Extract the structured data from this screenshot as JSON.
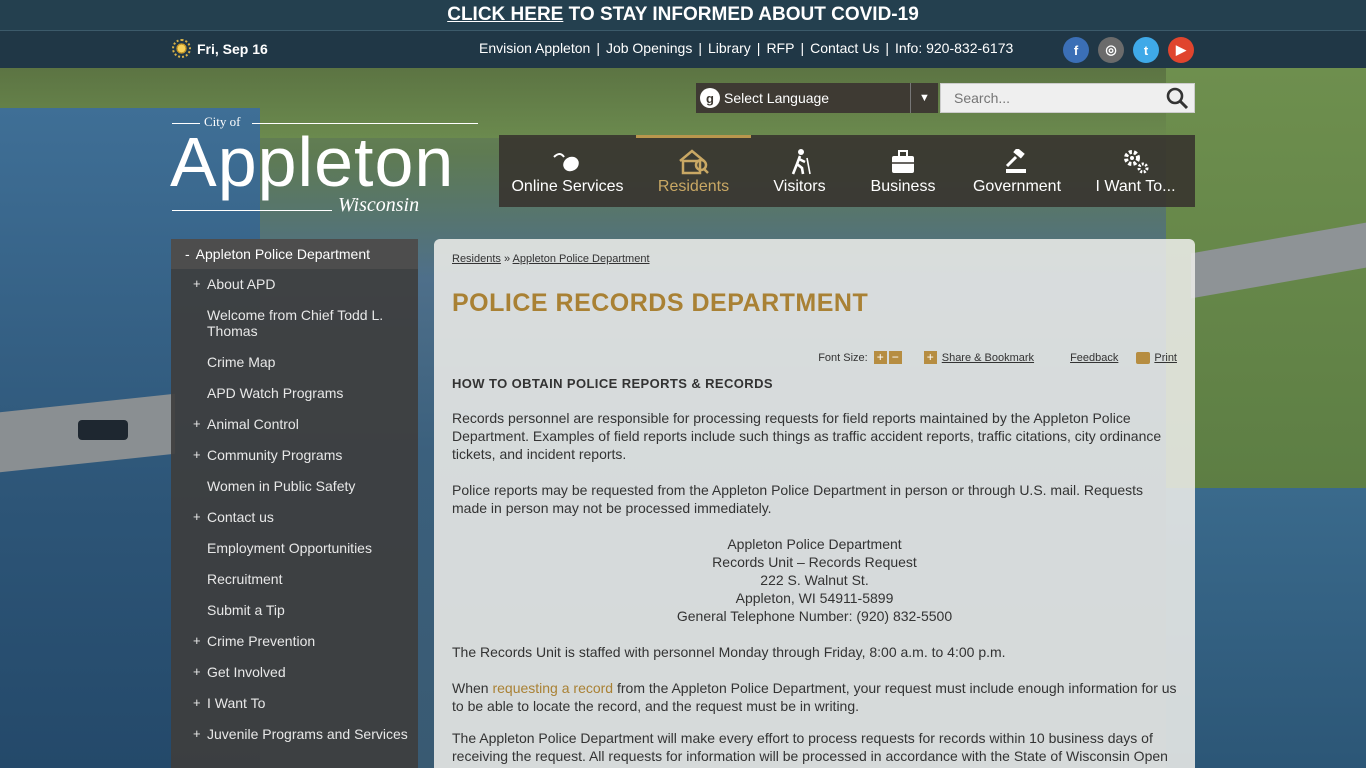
{
  "alert": {
    "link": "CLICK HERE",
    "text": " TO STAY INFORMED ABOUT COVID-19"
  },
  "utility": {
    "date": "Fri, Sep 16",
    "links": [
      "Envision Appleton",
      "Job Openings",
      "Library",
      "RFP",
      "Contact Us",
      "Info: 920-832-6173"
    ],
    "social": [
      {
        "name": "facebook",
        "glyph": "f",
        "color": "#3b6fb6"
      },
      {
        "name": "instagram",
        "glyph": "◎",
        "color": "#6b6b6b"
      },
      {
        "name": "twitter",
        "glyph": "t",
        "color": "#3fa9e8"
      },
      {
        "name": "youtube",
        "glyph": "▶",
        "color": "#e0452e"
      }
    ]
  },
  "logo": {
    "city_of": "City of",
    "name": "Appleton",
    "state": "Wisconsin"
  },
  "language": {
    "glyph": "g",
    "label": "Select Language",
    "arrow": "▼"
  },
  "search": {
    "placeholder": "Search..."
  },
  "nav": [
    "Online Services",
    "Residents",
    "Visitors",
    "Business",
    "Government",
    "I Want To..."
  ],
  "sidebar": {
    "heading": "Appleton Police Department",
    "items": [
      {
        "label": "About APD",
        "expand": "+"
      },
      {
        "label": "Welcome from Chief Todd L. Thomas",
        "expand": ""
      },
      {
        "label": "Crime Map",
        "expand": ""
      },
      {
        "label": "APD Watch Programs",
        "expand": ""
      },
      {
        "label": "Animal Control",
        "expand": "+"
      },
      {
        "label": "Community Programs",
        "expand": "+"
      },
      {
        "label": "Women in Public Safety",
        "expand": ""
      },
      {
        "label": "Contact us",
        "expand": "+"
      },
      {
        "label": "Employment Opportunities",
        "expand": ""
      },
      {
        "label": "Recruitment",
        "expand": ""
      },
      {
        "label": "Submit a Tip",
        "expand": ""
      },
      {
        "label": "Crime Prevention",
        "expand": "+"
      },
      {
        "label": "Get Involved",
        "expand": "+"
      },
      {
        "label": "I Want To",
        "expand": "+"
      },
      {
        "label": "Juvenile Programs and Services",
        "expand": "+"
      }
    ]
  },
  "breadcrumb": {
    "first": "Residents",
    "sep": " » ",
    "second": "Appleton Police Department"
  },
  "page_title": "POLICE RECORDS DEPARTMENT",
  "tools": {
    "font_size": "Font Size:",
    "share": "Share & Bookmark",
    "feedback": "Feedback",
    "print": "Print"
  },
  "content": {
    "section_title": "HOW TO OBTAIN POLICE REPORTS & RECORDS",
    "p1": "Records personnel are responsible for processing requests for field reports maintained by the Appleton Police Department. Examples of field reports include such things as traffic accident reports, traffic citations, city ordinance tickets, and incident reports.",
    "p2": "Police reports may be requested from the Appleton Police Department in person or through U.S. mail. Requests made in person may not be processed immediately.",
    "address": [
      "Appleton Police Department",
      "Records Unit – Records Request",
      "222 S. Walnut St.",
      "Appleton, WI 54911-5899",
      "General Telephone Number: (920) 832-5500"
    ],
    "p3": "The Records Unit is staffed with personnel Monday through Friday, 8:00 a.m. to 4:00 p.m.",
    "p4_pre": "When ",
    "p4_link": "requesting a record",
    "p4_post": " from the Appleton Police Department, your request must include enough information for us to be able to locate the record, and the request must be in writing.",
    "p5": "The Appleton Police Department will make every effort to process requests for records within 10 business days of receiving the request. All requests for information will be processed in accordance with the State of Wisconsin Open"
  }
}
